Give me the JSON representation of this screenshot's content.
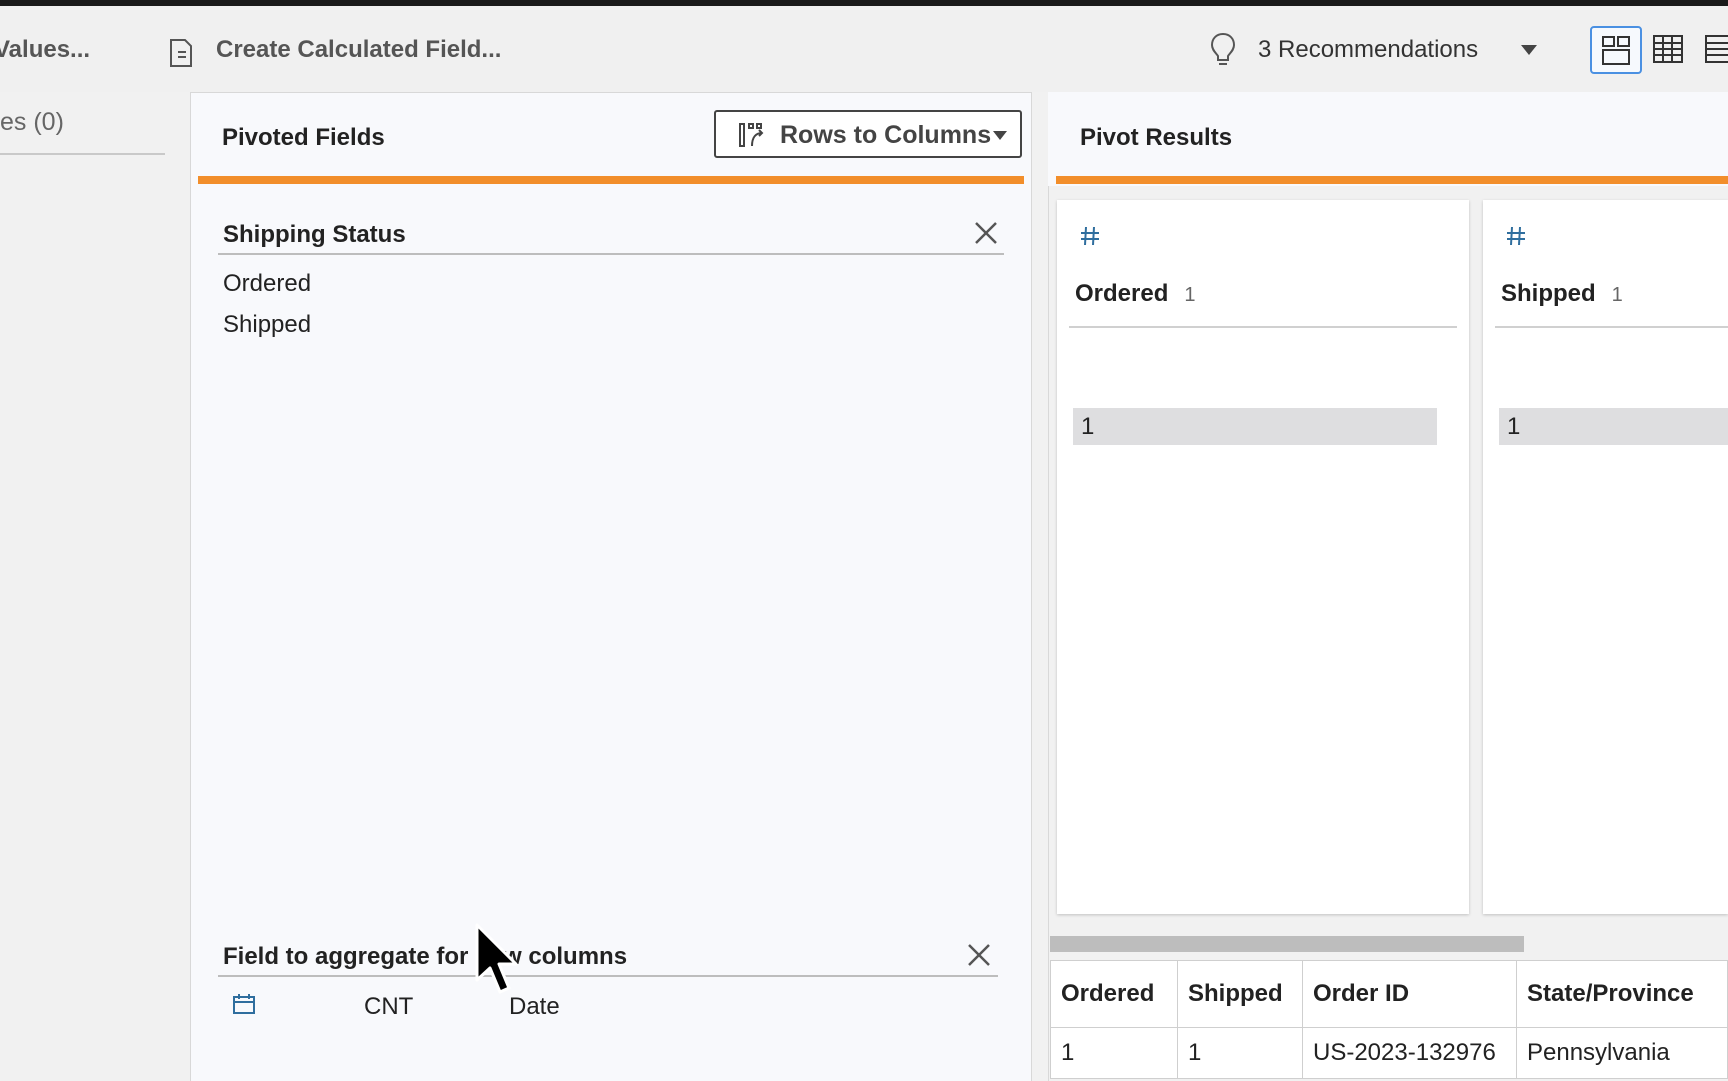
{
  "toolbar": {
    "values_label": "Values...",
    "calc_field_label": "Create Calculated Field...",
    "recommendations_label": "3 Recommendations"
  },
  "left_panel": {
    "label": "es (0)"
  },
  "pivoted_fields": {
    "title": "Pivoted Fields",
    "pivot_type": "Rows to Columns",
    "accent_color": "#f28e2b",
    "section_title": "Shipping Status",
    "values": [
      "Ordered",
      "Shipped"
    ],
    "aggregate_title": "Field to aggregate for new columns",
    "aggregate": {
      "function": "CNT",
      "field": "Date",
      "icon": "calendar-icon"
    }
  },
  "pivot_results": {
    "title": "Pivot Results",
    "cards": [
      {
        "name": "Ordered",
        "count": "1",
        "value": "1",
        "icon": "number-hash-icon"
      },
      {
        "name": "Shipped",
        "count": "1",
        "value": "1",
        "icon": "number-hash-icon"
      }
    ],
    "table": {
      "headers": [
        "Ordered",
        "Shipped",
        "Order ID",
        "State/Province"
      ],
      "rows": [
        [
          "1",
          "1",
          "US-2023-132976",
          "Pennsylvania"
        ]
      ]
    }
  }
}
